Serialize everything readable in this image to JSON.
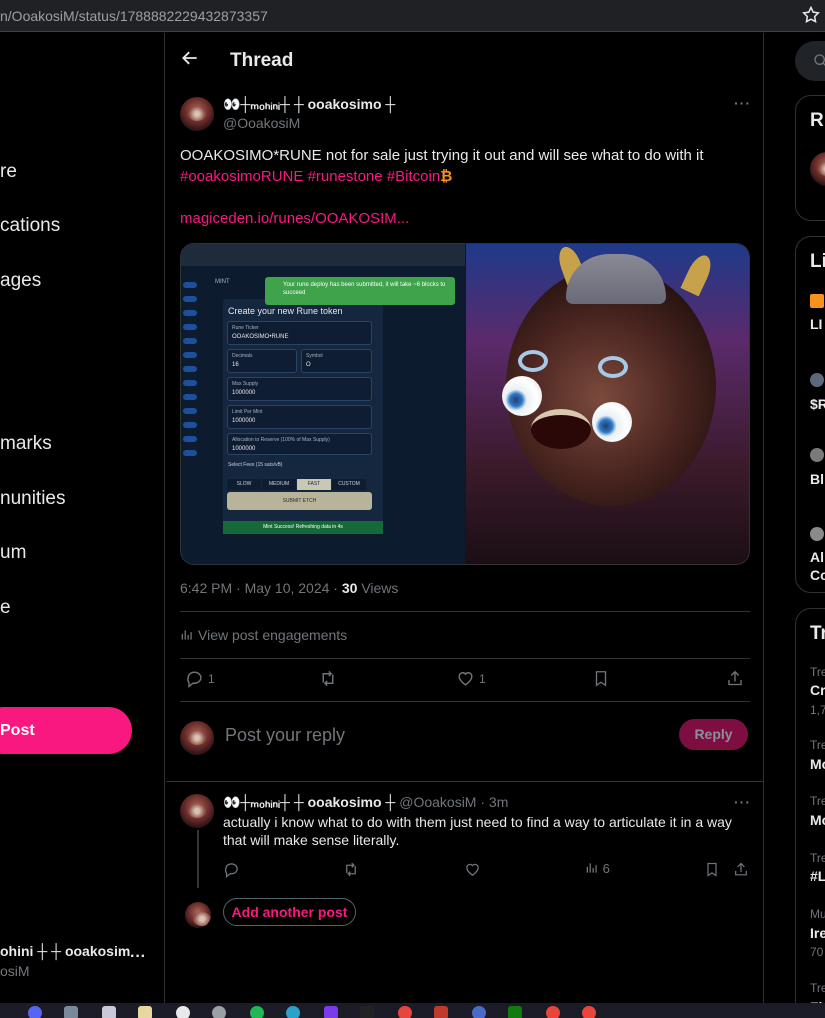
{
  "browser": {
    "url": "n/OoakosiM/status/1788882229432873357"
  },
  "leftnav": {
    "items": [
      "re",
      "cations",
      "ages",
      "marks",
      "nunities",
      "um",
      "e"
    ],
    "post_label": "Post",
    "account_name": "ohini ┼ ┼ ooakosim",
    "account_handle": "osiM"
  },
  "header": {
    "title": "Thread"
  },
  "post": {
    "author_name": "👀┼ₘₒₕᵢₙᵢ┼ ┼ ooakosimo ┼",
    "author_handle": "@OoakosiM",
    "text": "OOAKOSIMO*RUNE not for sale just trying it out and will see what to do with it",
    "hashtags": [
      "#ooakosimoRUNE",
      "#runestone",
      "#Bitcoin"
    ],
    "link": "magiceden.io/runes/OOAKOSIM...",
    "time": "6:42 PM · May 10, 2024 · ",
    "views_count": "30",
    "views_label": " Views",
    "engagements_label": "View post engagements",
    "reply_count": "1",
    "retweet_count": "",
    "like_count": "1"
  },
  "media_screenshot": {
    "toast": "Your rune deploy has been submitted, it will take ~6 blocks to succeed",
    "tab_mint": "MINT",
    "panel_title": "Create your new Rune token",
    "rune_ticker_label": "Rune Ticker",
    "rune_ticker_value": "OOAKOSIMO•RUNE",
    "decimals_label": "Decimals",
    "decimals_value": "16",
    "symbol_label": "Symbol",
    "symbol_value": "O",
    "max_supply_label": "Max Supply",
    "max_supply_value": "1000000",
    "limit_label": "Limit Per Mint",
    "limit_value": "1000000",
    "allocation_label": "Allocation to Reserve (100% of Max Supply)",
    "allocation_value": "1000000",
    "fees_label": "Select Fees (15 sats/vB)",
    "fees": [
      "SLOW",
      "MEDIUM",
      "FAST",
      "CUSTOM"
    ],
    "submit": "SUBMIT ETCH",
    "success": "Mint Success! Refreshing data in 4s"
  },
  "reply_box": {
    "placeholder": "Post your reply",
    "button": "Reply"
  },
  "reply": {
    "author_name": "👀┼ₘₒₕᵢₙᵢ┼ ┼ ooakosimo ┼",
    "author_handle": "@OoakosiM · 3m",
    "text": "actually i know what to do with them just need to find a way to articulate it in a way that will make sense literally.",
    "views": "6",
    "add_another": "Add another post"
  },
  "rightcol": {
    "card1_head": "R",
    "card2_head": "Li",
    "card2_items": [
      "LI",
      "$R",
      "Bl",
      "Al",
      "Co"
    ],
    "card3_head": "Tr",
    "trend_small": [
      "Tre",
      "1,7",
      "Tre",
      "Tre",
      "Tre",
      "Mu",
      "70",
      "Tre"
    ],
    "trend_bold": [
      "Cr",
      "Mo",
      "Mo",
      "#L",
      "Ire",
      "Fl"
    ]
  }
}
